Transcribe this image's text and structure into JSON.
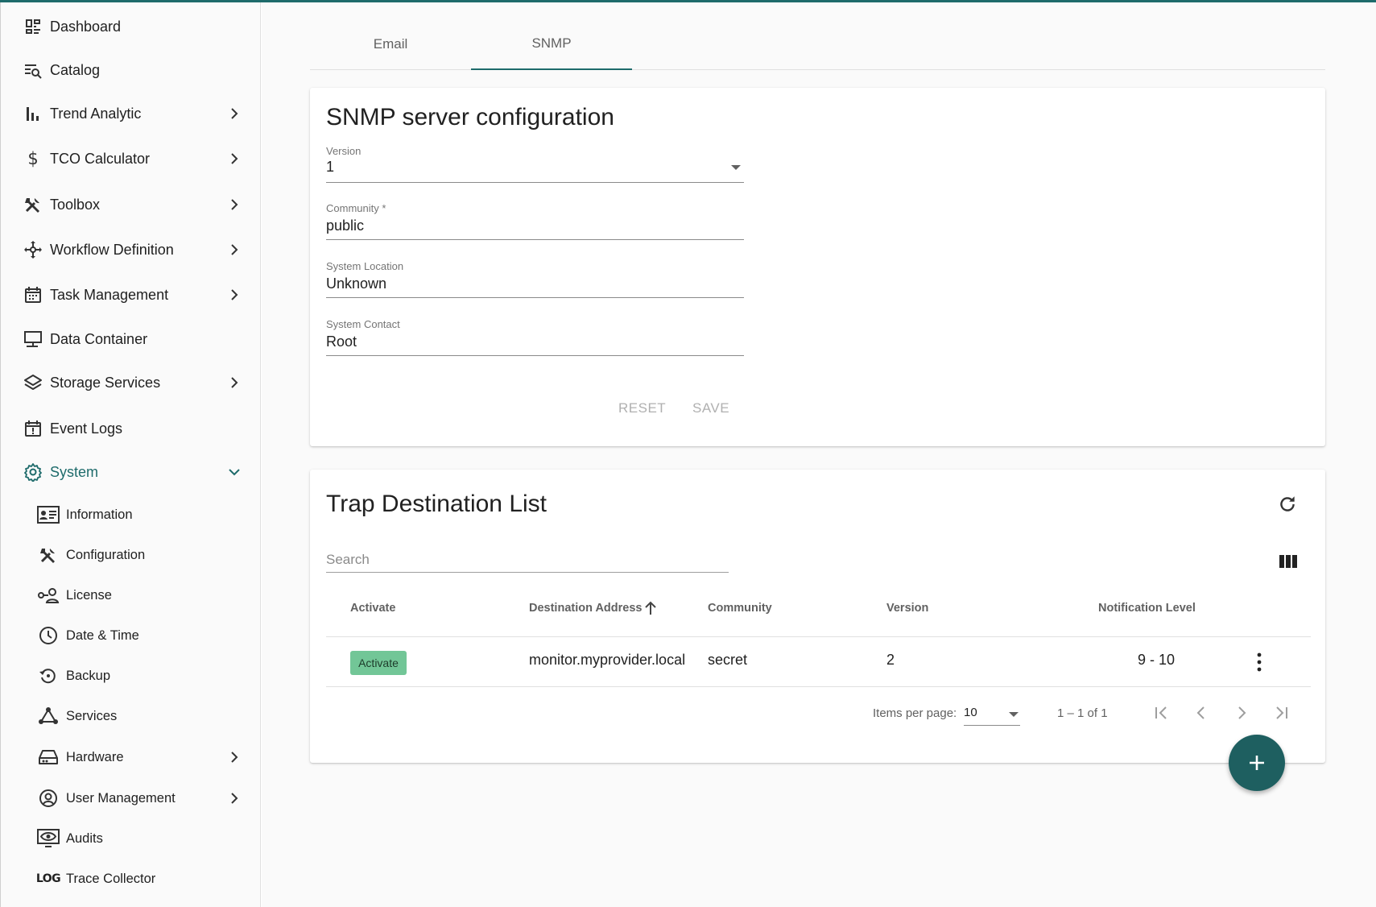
{
  "sidebar": {
    "items": [
      {
        "label": "Dashboard",
        "icon": "dashboard-icon"
      },
      {
        "label": "Catalog",
        "icon": "catalog-search-icon"
      },
      {
        "label": "Trend Analytic",
        "icon": "bar-chart-icon"
      },
      {
        "label": "TCO Calculator",
        "icon": "dollar-icon"
      },
      {
        "label": "Toolbox",
        "icon": "tools-icon"
      },
      {
        "label": "Workflow Definition",
        "icon": "workflow-icon"
      },
      {
        "label": "Task Management",
        "icon": "calendar-icon"
      },
      {
        "label": "Data Container",
        "icon": "monitor-icon"
      },
      {
        "label": "Storage Services",
        "icon": "layers-icon"
      },
      {
        "label": "Event Logs",
        "icon": "event-alert-icon"
      },
      {
        "label": "System",
        "icon": "gear-icon"
      }
    ],
    "system_children": [
      {
        "label": "Information",
        "icon": "id-card-icon"
      },
      {
        "label": "Configuration",
        "icon": "tools-icon"
      },
      {
        "label": "License",
        "icon": "license-key-icon"
      },
      {
        "label": "Date & Time",
        "icon": "clock-icon"
      },
      {
        "label": "Backup",
        "icon": "restore-icon"
      },
      {
        "label": "Services",
        "icon": "services-graph-icon"
      },
      {
        "label": "Hardware",
        "icon": "hardware-icon"
      },
      {
        "label": "User Management",
        "icon": "user-circle-icon"
      },
      {
        "label": "Audits",
        "icon": "audit-eye-icon"
      },
      {
        "label": "Trace Collector",
        "icon": "log-icon",
        "icon_text": "LOG"
      }
    ]
  },
  "tabs": [
    "Email",
    "SNMP"
  ],
  "active_tab": "SNMP",
  "snmp_config": {
    "title": "SNMP server configuration",
    "version_label": "Version",
    "version_value": "1",
    "community_label": "Community *",
    "community_value": "public",
    "location_label": "System Location",
    "location_value": "Unknown",
    "contact_label": "System Contact",
    "contact_value": "Root",
    "reset_label": "RESET",
    "save_label": "SAVE"
  },
  "trap_list": {
    "title": "Trap Destination List",
    "search_placeholder": "Search",
    "columns": [
      "Activate",
      "Destination Address",
      "Community",
      "Version",
      "Notification Level"
    ],
    "rows": [
      {
        "activate": "Activate",
        "destination": "monitor.myprovider.local",
        "community": "secret",
        "version": "2",
        "notification_level": "9 - 10"
      }
    ],
    "items_per_page_label": "Items per page:",
    "items_per_page_value": "10",
    "range_label": "1 – 1 of 1"
  },
  "colors": {
    "accent": "#1e6b6b",
    "badge": "#72c697",
    "fab": "#1e5f60"
  }
}
